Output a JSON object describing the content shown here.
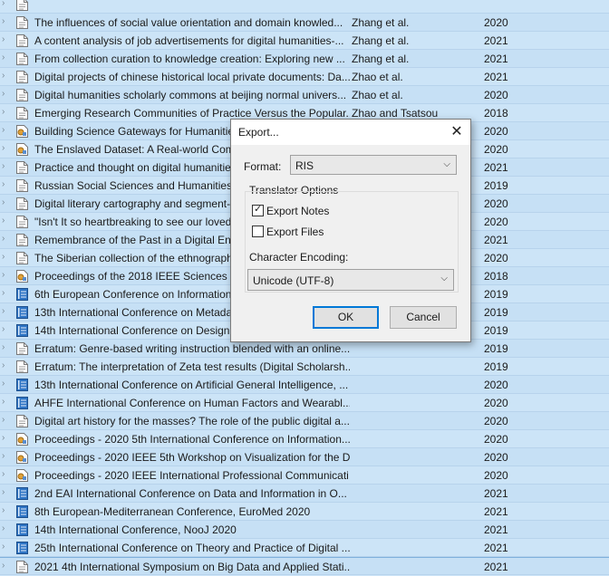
{
  "rows": [
    {
      "title": "",
      "creator": "",
      "year": "",
      "icon": "document-icon"
    },
    {
      "title": "The influences of social value orientation and domain knowled...",
      "creator": "Zhang et al.",
      "year": "2020",
      "icon": "document-icon"
    },
    {
      "title": "A content analysis of job advertisements for digital humanities-...",
      "creator": "Zhang et al.",
      "year": "2021",
      "icon": "document-icon"
    },
    {
      "title": "From collection curation to knowledge creation: Exploring new ...",
      "creator": "Zhang et al.",
      "year": "2021",
      "icon": "document-icon"
    },
    {
      "title": "Digital projects of chinese historical local private documents: Da...",
      "creator": "Zhao et al.",
      "year": "2021",
      "icon": "document-icon"
    },
    {
      "title": "Digital humanities scholarly commons at beijing normal univers...",
      "creator": "Zhao et al.",
      "year": "2020",
      "icon": "document-icon"
    },
    {
      "title": "Emerging Research Communities of Practice Versus the Popular...",
      "creator": "Zhao and Tsatsou",
      "year": "2018",
      "icon": "document-icon"
    },
    {
      "title": "Building Science Gateways for Humanities",
      "creator": "",
      "year": "2020",
      "icon": "conference-paper-icon"
    },
    {
      "title": "The Enslaved Dataset: A Real-world Complex",
      "creator": "",
      "year": "2020",
      "icon": "conference-paper-icon"
    },
    {
      "title": "Practice and thought on digital humanities",
      "creator": "",
      "year": "2021",
      "icon": "document-icon"
    },
    {
      "title": "Russian Social Sciences and Humanities E",
      "creator": "",
      "year": "2019",
      "icon": "document-icon"
    },
    {
      "title": "Digital literary cartography and segment-",
      "creator": "",
      "year": "2020",
      "icon": "document-icon"
    },
    {
      "title": "\"Isn't It so heartbreaking to see our loved",
      "creator": "",
      "year": "2020",
      "icon": "document-icon"
    },
    {
      "title": "Remembrance of the Past in a Digital Env",
      "creator": "",
      "year": "2021",
      "icon": "document-icon"
    },
    {
      "title": "The Siberian collection of the ethnograph",
      "creator": "",
      "year": "2020",
      "icon": "document-icon"
    },
    {
      "title": "Proceedings of the 2018 IEEE Sciences and",
      "creator": "",
      "year": "2018",
      "icon": "conference-paper-icon"
    },
    {
      "title": "6th European Conference on Information",
      "creator": "",
      "year": "2019",
      "icon": "book-icon"
    },
    {
      "title": "13th International Conference on Metada",
      "creator": "",
      "year": "2019",
      "icon": "book-icon"
    },
    {
      "title": "14th International Conference on Design",
      "creator": "",
      "year": "2019",
      "icon": "book-icon"
    },
    {
      "title": "Erratum: Genre-based writing instruction blended with an online...",
      "creator": "",
      "year": "2019",
      "icon": "document-icon"
    },
    {
      "title": "Erratum: The interpretation of Zeta test results (Digital Scholarsh...",
      "creator": "",
      "year": "2019",
      "icon": "document-icon"
    },
    {
      "title": "13th International Conference on Artificial General Intelligence, ...",
      "creator": "",
      "year": "2020",
      "icon": "book-icon"
    },
    {
      "title": "AHFE International Conference on Human Factors and Wearabl...",
      "creator": "",
      "year": "2020",
      "icon": "book-icon"
    },
    {
      "title": "Digital art history for the masses? The role of the public digital a...",
      "creator": "",
      "year": "2020",
      "icon": "document-icon"
    },
    {
      "title": "Proceedings - 2020 5th International Conference on Information...",
      "creator": "",
      "year": "2020",
      "icon": "conference-paper-icon"
    },
    {
      "title": "Proceedings - 2020 IEEE 5th Workshop on Visualization for the D...",
      "creator": "",
      "year": "2020",
      "icon": "conference-paper-icon"
    },
    {
      "title": "Proceedings - 2020 IEEE International Professional Communicati...",
      "creator": "",
      "year": "2020",
      "icon": "conference-paper-icon"
    },
    {
      "title": "2nd EAI International Conference on Data and Information in O...",
      "creator": "",
      "year": "2021",
      "icon": "book-icon"
    },
    {
      "title": "8th European-Mediterranean Conference, EuroMed 2020",
      "creator": "",
      "year": "2021",
      "icon": "book-icon"
    },
    {
      "title": "14th International Conference, NooJ 2020",
      "creator": "",
      "year": "2021",
      "icon": "book-icon"
    },
    {
      "title": "25th International Conference on Theory and Practice of Digital ...",
      "creator": "",
      "year": "2021",
      "icon": "book-icon"
    },
    {
      "title": "2021 4th International Symposium on Big Data and Applied Stati...",
      "creator": "",
      "year": "2021",
      "icon": "document-icon"
    }
  ],
  "dialog": {
    "title": "Export...",
    "format_label": "Format:",
    "format_value": "RIS",
    "translator_group_label": "Translator Options",
    "export_notes_label": "Export Notes",
    "export_notes_checked": true,
    "export_files_label": "Export Files",
    "export_files_checked": false,
    "encoding_label": "Character Encoding:",
    "encoding_value": "Unicode (UTF-8)",
    "ok_label": "OK",
    "cancel_label": "Cancel"
  },
  "colors": {
    "selection": "#cce4f7",
    "default_button_border": "#0078d7",
    "book_icon": "#2e74c4"
  }
}
